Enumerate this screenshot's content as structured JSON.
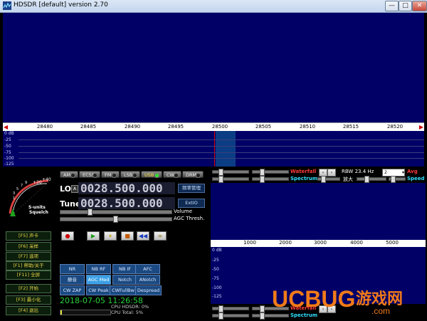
{
  "window": {
    "title": "HDSDR  [default]  version 2.70",
    "minimize": "—",
    "maximize": "□",
    "close": "✕"
  },
  "main_scale": {
    "ticks": [
      "28480",
      "28485",
      "28490",
      "28495",
      "28500",
      "28505",
      "28510",
      "28515",
      "28520"
    ],
    "left_arrow": "◀",
    "right_arrow": "▶"
  },
  "spectrum_db": [
    "0 dB",
    "-25",
    "-50",
    "-75",
    "-100",
    "-125"
  ],
  "modes": [
    {
      "label": "AM"
    },
    {
      "label": "ECSS"
    },
    {
      "label": "FM"
    },
    {
      "label": "LSB"
    },
    {
      "label": "USB",
      "active": true
    },
    {
      "label": "CW"
    },
    {
      "label": "DRM"
    }
  ],
  "smeter": {
    "scale_plus20": "+20",
    "scale_plus40": "+40",
    "label1": "S-units",
    "label2": "Squelch",
    "nums": [
      "1",
      "3",
      "5",
      "7",
      "9"
    ]
  },
  "lo": {
    "label": "LO",
    "lock": "A",
    "value": "0028.500.000"
  },
  "tune": {
    "label": "Tune",
    "value": "0028.500.000"
  },
  "buttons": {
    "freq_mgr": "频率管理",
    "extio": "ExtIO"
  },
  "sliders": {
    "volume": "Volume",
    "agc": "AGC Thresh."
  },
  "fkeys": [
    {
      "label": "[F5] 声卡"
    },
    {
      "label": "[F6] 采样"
    },
    {
      "label": "[F7] 选项"
    },
    {
      "label": "[F1] 帮助/关于"
    },
    {
      "label": "[F11] 全屏"
    },
    {
      "label": "[F2] 开始"
    },
    {
      "label": "[F3] 最小化"
    },
    {
      "label": "[F4] 退出"
    }
  ],
  "transport": {
    "record": "●",
    "play": "▶",
    "pause": "⏸",
    "stop": "■",
    "rewind": "◀◀",
    "loop": "∞"
  },
  "dsp": [
    [
      "NR",
      "NB RF",
      "NB IF",
      "AFC"
    ],
    [
      "静音",
      "AGC Med",
      "Notch",
      "ANotch"
    ],
    [
      "CW ZAP",
      "CW Peak",
      "CWFullBw",
      "Despread"
    ]
  ],
  "clock": "2018-07-05 11:26:58",
  "cpu": {
    "hdsdr": "CPU HDSDR: 0%",
    "total": "CPU Total: 5%"
  },
  "right_panel": {
    "waterfall_label": "Waterfall",
    "spectrum_label": "Spectrum",
    "rbw": "RBW 23.4 Hz",
    "zoom": "放大",
    "avg": "Avg",
    "avg_value": "2",
    "speed": "Speed",
    "scale_ticks": [
      "1000",
      "2000",
      "3000",
      "4000",
      "5000"
    ],
    "db": [
      "0 dB",
      "-25",
      "-50",
      "-75",
      "-100",
      "-125"
    ]
  },
  "watermark": {
    "text1": "UCBUG",
    "text2": "游戏网",
    "text3": ".com"
  },
  "colors": {
    "waterfall_bg": "#000067",
    "accent_red": "#ff3a3a",
    "accent_cyan": "#2fe0ff",
    "clock_green": "#27d23a"
  }
}
